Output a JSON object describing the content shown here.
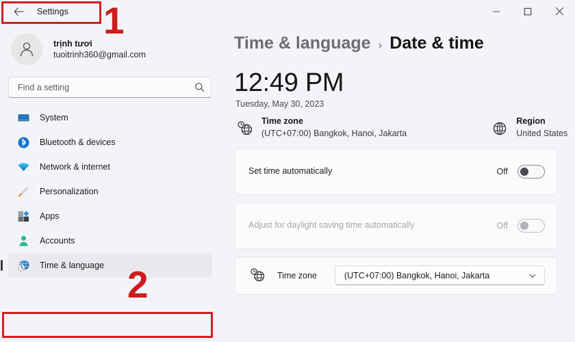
{
  "window": {
    "titlebar_title": "Settings",
    "back_icon": "back-arrow-icon",
    "controls": {
      "minimize": "minimize-icon",
      "maximize": "maximize-icon",
      "close": "close-icon"
    }
  },
  "account": {
    "name": "trịnh tươi",
    "email": "tuoitrinh360@gmail.com",
    "avatar_icon": "person-avatar-icon"
  },
  "search": {
    "placeholder": "Find a setting",
    "value": "",
    "icon": "search-icon"
  },
  "sidebar": {
    "items": [
      {
        "label": "System",
        "icon": "monitor-icon",
        "selected": false
      },
      {
        "label": "Bluetooth & devices",
        "icon": "bluetooth-icon",
        "selected": false
      },
      {
        "label": "Network & internet",
        "icon": "wifi-icon",
        "selected": false
      },
      {
        "label": "Personalization",
        "icon": "paintbrush-icon",
        "selected": false
      },
      {
        "label": "Apps",
        "icon": "apps-grid-icon",
        "selected": false
      },
      {
        "label": "Accounts",
        "icon": "person-icon",
        "selected": false
      },
      {
        "label": "Time & language",
        "icon": "clock-globe-icon",
        "selected": true
      }
    ]
  },
  "main": {
    "breadcrumb": {
      "parent": "Time & language",
      "separator": "›",
      "current": "Date & time"
    },
    "clock": "12:49 PM",
    "date": "Tuesday, May 30, 2023",
    "info": [
      {
        "icon": "clock-globe-icon",
        "title": "Time zone",
        "subtitle": "(UTC+07:00) Bangkok, Hanoi, Jakarta"
      },
      {
        "icon": "globe-icon",
        "title": "Region",
        "subtitle": "United States"
      }
    ],
    "cards": [
      {
        "label": "Set time automatically",
        "toggle_state": "Off",
        "disabled": false
      },
      {
        "label": "Adjust for daylight saving time automatically",
        "toggle_state": "Off",
        "disabled": true
      }
    ],
    "timezone_card": {
      "icon": "clock-globe-icon",
      "label": "Time zone",
      "selected_value": "(UTC+07:00) Bangkok, Hanoi, Jakarta",
      "chevron_icon": "chevron-down-icon"
    }
  },
  "annotations": {
    "marker_1": "1",
    "marker_2": "2",
    "highlight_color": "#d11f1f"
  }
}
